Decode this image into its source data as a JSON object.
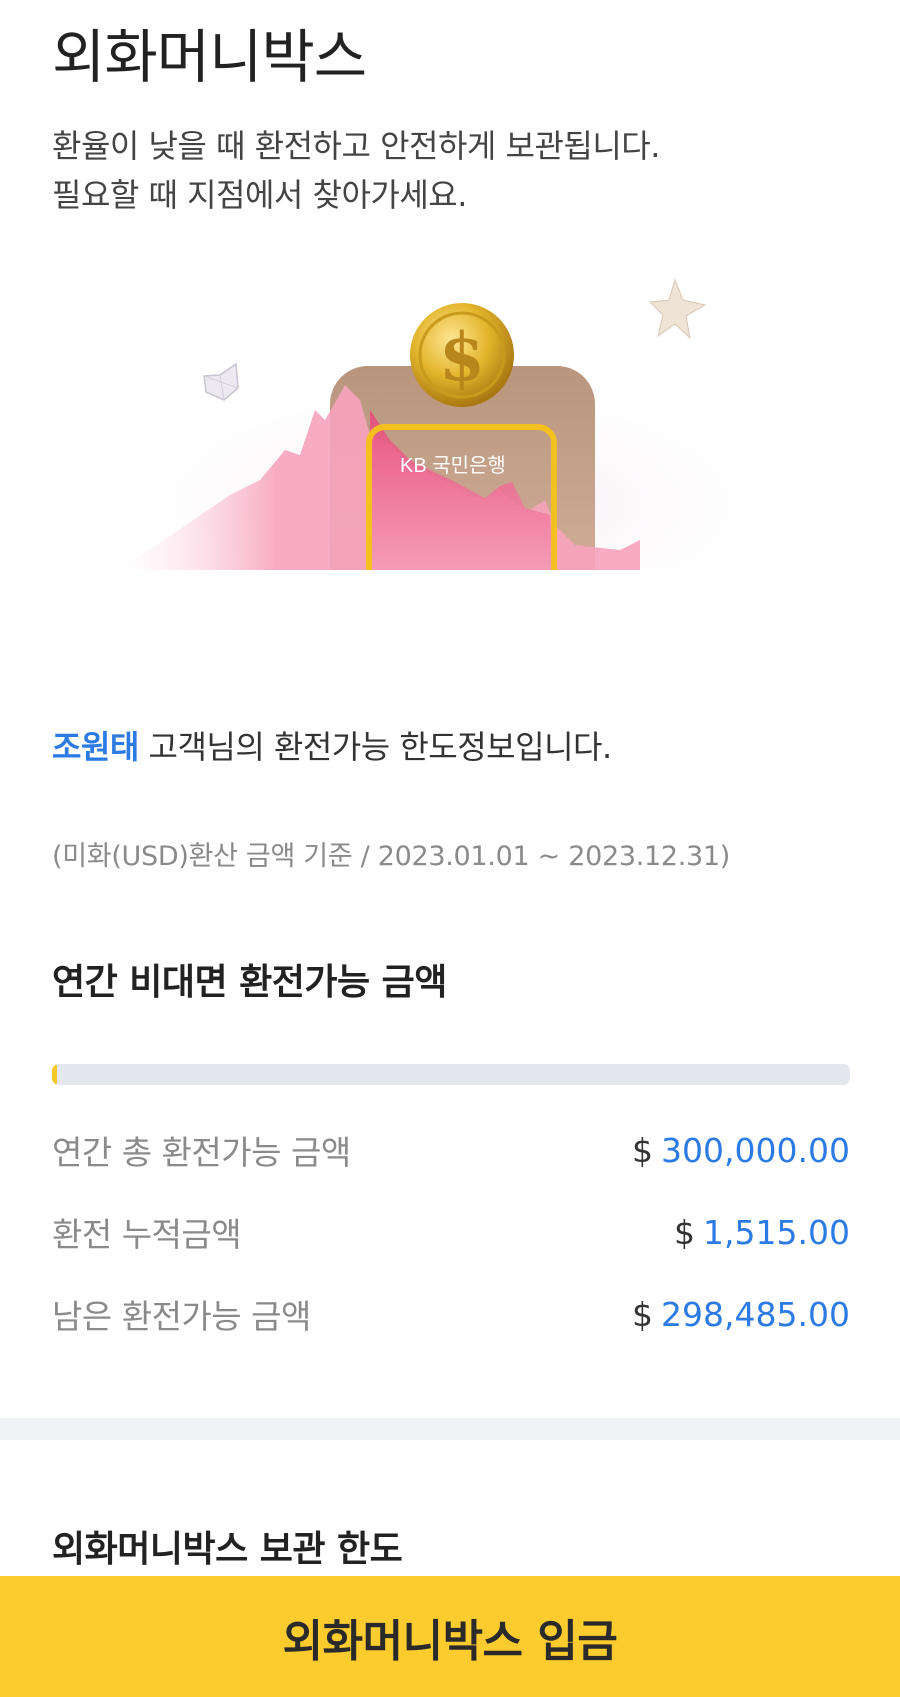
{
  "header": {
    "title": "외화머니박스",
    "subtitle_lines": [
      "환율이 낮을 때 환전하고 안전하게 보관됩니다.",
      "필요할 때 지점에서 찾아가세요."
    ]
  },
  "hero": {
    "bank_logo_text": "KB 국민은행",
    "coin_symbol": "$",
    "icons": [
      "coin-icon",
      "star-icon",
      "gem-icon",
      "chart-graphic"
    ]
  },
  "info": {
    "customer_name": "조원태",
    "greeting_suffix": " 고객님의 환전가능 한도정보입니다.",
    "basis": "(미화(USD)환산 금액 기준 / 2023.01.01 ~ 2023.12.31)"
  },
  "limit": {
    "title": "연간 비대면 환전가능 금액",
    "progress_fraction": 0.00505,
    "rows": [
      {
        "label": "연간 총 환전가능 금액",
        "currency": "$",
        "amount": "300,000.00"
      },
      {
        "label": "환전 누적금액",
        "currency": "$",
        "amount": "1,515.00"
      },
      {
        "label": "남은 환전가능 금액",
        "currency": "$",
        "amount": "298,485.00"
      }
    ]
  },
  "storage": {
    "title": "외화머니박스 보관 한도"
  },
  "cta": {
    "label": "외화머니박스 입금"
  },
  "colors": {
    "accent_blue": "#2c7be5",
    "brand_yellow": "#fccc2f",
    "progress_yellow": "#f7c924",
    "track_gray": "#e4e7ee"
  }
}
